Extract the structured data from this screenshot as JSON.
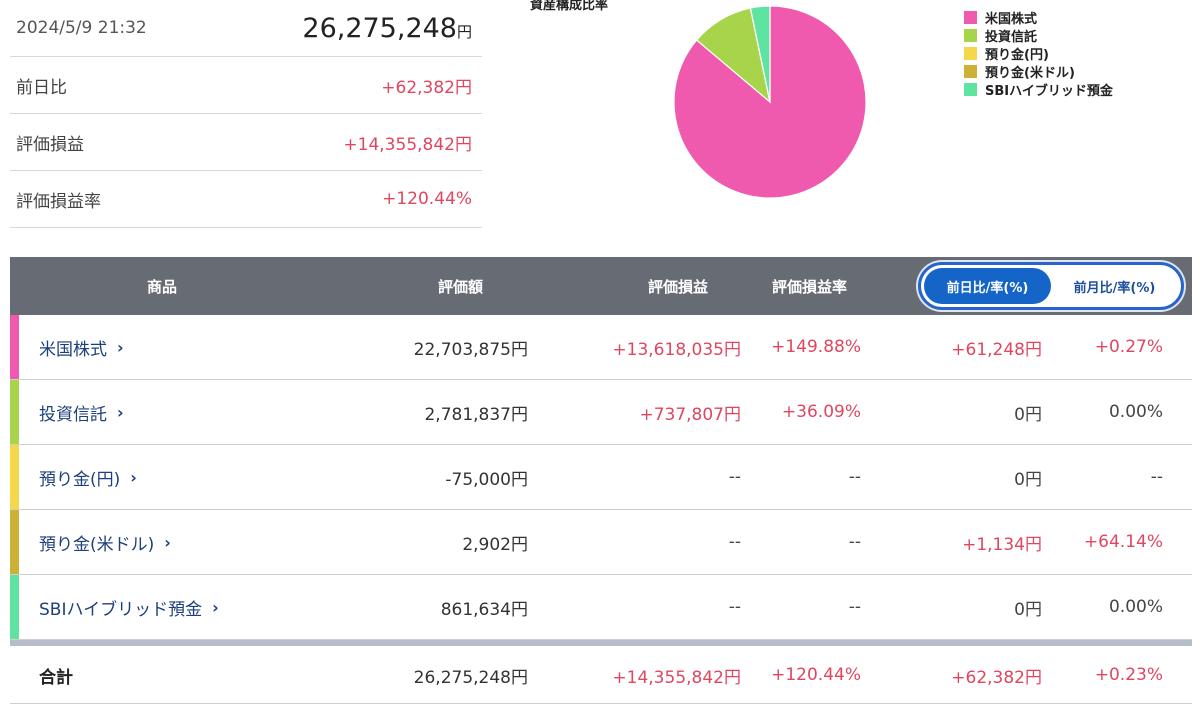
{
  "summary": {
    "datetime": "2024/5/9 21:32",
    "total": "26,275,248",
    "total_unit": "円",
    "rows": [
      {
        "label": "前日比",
        "value": "+62,382円"
      },
      {
        "label": "評価損益",
        "value": "+14,355,842円"
      },
      {
        "label": "評価損益率",
        "value": "+120.44%"
      }
    ]
  },
  "chart_title": "資産構成比率",
  "chart_data": {
    "type": "pie",
    "title": "資産構成比率",
    "labels": [
      "米国株式",
      "投資信託",
      "預り金(円)",
      "預り金(米ドル)",
      "SBIハイブリッド預金"
    ],
    "values": [
      22703875,
      2781837,
      0,
      2902,
      861634
    ],
    "colors": [
      "#ef5aae",
      "#a7d44a",
      "#f5d84a",
      "#cdb137",
      "#5fe3a1"
    ],
    "legend": "right"
  },
  "table": {
    "headers": {
      "product": "商品",
      "amount": "評価額",
      "gain": "評価損益",
      "rate": "評価損益率"
    },
    "toggle": {
      "active": "前日比/率(%)",
      "inactive": "前月比/率(%)"
    },
    "rows": [
      {
        "name": "米国株式",
        "chev": "›",
        "color": "#ef5aae",
        "amount": "22,703,875円",
        "gain": "+13,618,035円",
        "rate": "+149.88%",
        "day": "+61,248円",
        "dayrate": "+0.27%"
      },
      {
        "name": "投資信託",
        "chev": "›",
        "color": "#a7d44a",
        "amount": "2,781,837円",
        "gain": "+737,807円",
        "rate": "+36.09%",
        "day": "0円",
        "dayrate": "0.00%"
      },
      {
        "name": "預り金(円)",
        "chev": "›",
        "color": "#f5d84a",
        "amount": "-75,000円",
        "gain": "--",
        "rate": "--",
        "day": "0円",
        "dayrate": "--"
      },
      {
        "name": "預り金(米ドル)",
        "chev": "›",
        "color": "#cdb137",
        "amount": "2,902円",
        "gain": "--",
        "rate": "--",
        "day": "+1,134円",
        "dayrate": "+64.14%"
      },
      {
        "name": "SBIハイブリッド預金",
        "chev": "›",
        "color": "#5fe3a1",
        "amount": "861,634円",
        "gain": "--",
        "rate": "--",
        "day": "0円",
        "dayrate": "0.00%"
      }
    ],
    "total": {
      "label": "合計",
      "amount": "26,275,248円",
      "gain": "+14,355,842円",
      "rate": "+120.44%",
      "day": "+62,382円",
      "dayrate": "+0.23%"
    }
  }
}
